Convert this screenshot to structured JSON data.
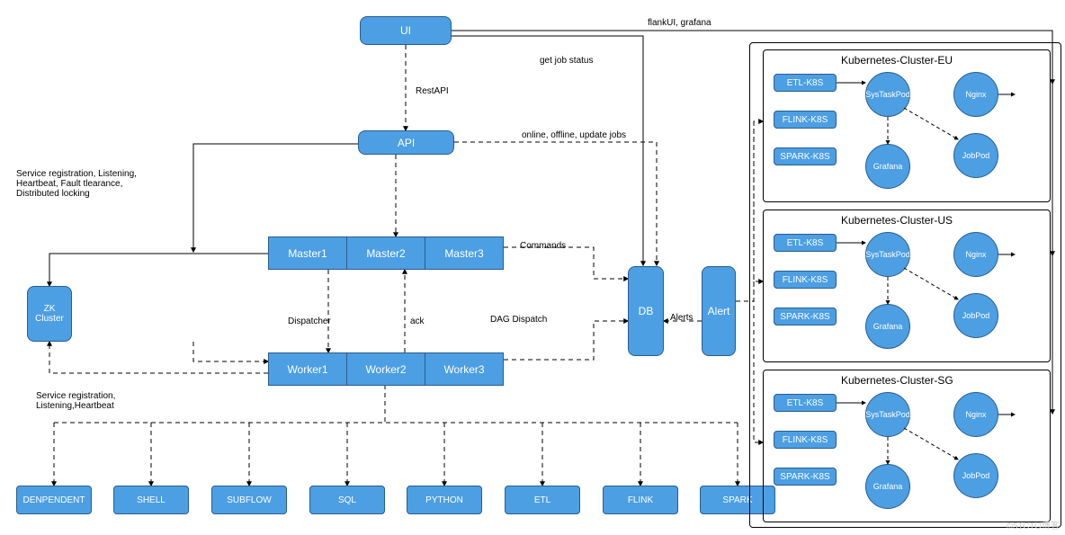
{
  "nodes": {
    "ui": "UI",
    "api": "API",
    "zk": "ZK\nCluster",
    "masters": [
      "Master1",
      "Master2",
      "Master3"
    ],
    "workers": [
      "Worker1",
      "Worker2",
      "Worker3"
    ],
    "db": "DB",
    "alert": "Alert",
    "bottom": [
      "DENPENDENT",
      "SHELL",
      "SUBFLOW",
      "SQL",
      "PYTHON",
      "ETL",
      "FLINK",
      "SPARK"
    ],
    "cluster_titles": [
      "Kubernetes-Cluster-EU",
      "Kubernetes-Cluster-US",
      "Kubernetes-Cluster-SG"
    ],
    "cluster_left": [
      "ETL-K8S",
      "FLINK-K8S",
      "SPARK-K8S"
    ],
    "cluster_circles": [
      "SysTaskPod",
      "Nginx",
      "Grafana",
      "JobPod"
    ]
  },
  "edge_labels": {
    "flank": "flankUI, grafana",
    "getjob": "get job status",
    "restapi": "RestAPI",
    "online": "online, offline, update jobs",
    "reg_master": "Service registration, Listening,\nHeartbeat, Fault tlearance,\nDistributed locking",
    "reg_worker": "Service registration,\nListening,Heartbeat",
    "commands": "Commands",
    "dispatcher": "Dispatcher",
    "ack": "ack",
    "dag": "DAG Dispatch",
    "alerts": "Alerts"
  },
  "watermark": "©51CTO博客"
}
